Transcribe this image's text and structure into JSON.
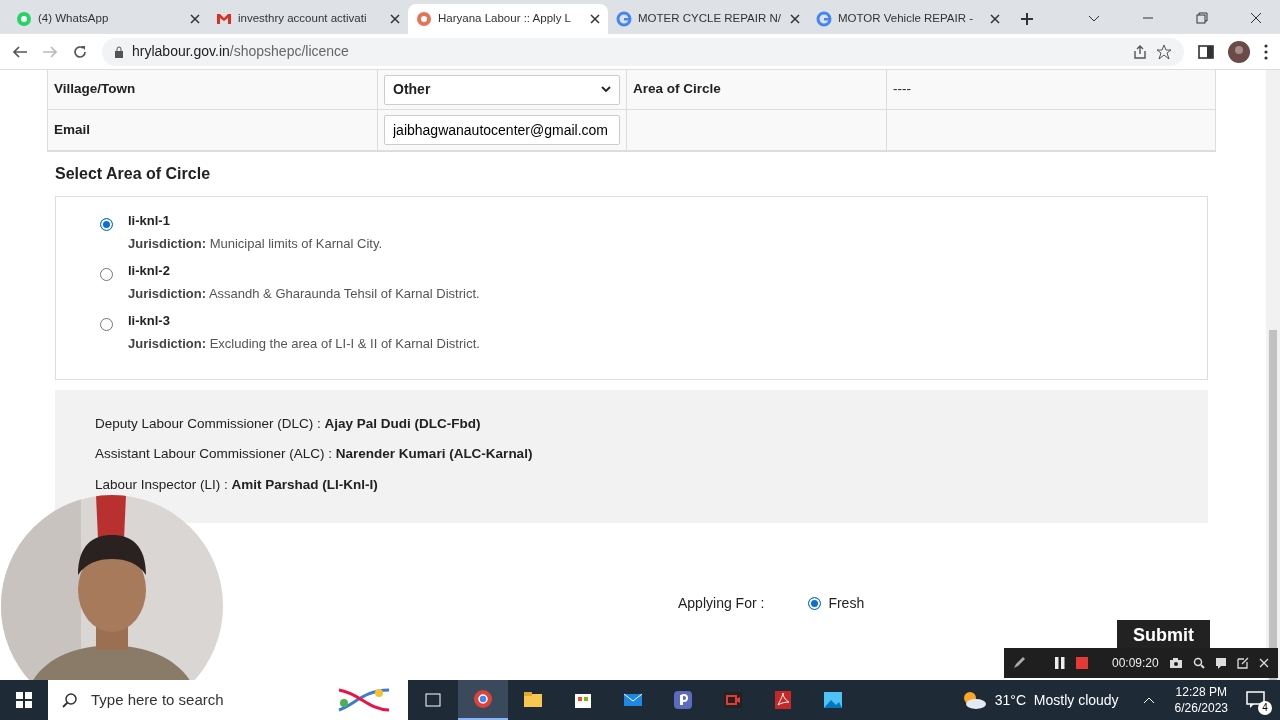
{
  "browser": {
    "tabs": [
      {
        "title": "(4) WhatsApp",
        "selected": false
      },
      {
        "title": "investhry account activati",
        "selected": false
      },
      {
        "title": "Haryana Labour :: Apply L",
        "selected": true
      },
      {
        "title": "MOTER CYCLE REPAIR N/",
        "selected": false
      },
      {
        "title": "MOTOR Vehicle REPAIR -",
        "selected": false
      }
    ],
    "url_host": "hrylabour.gov.in",
    "url_path": "/shopshepc/licence"
  },
  "form_rows": [
    {
      "label": "Village/Town",
      "field": {
        "kind": "select",
        "value": "Other"
      },
      "label_2": "Area of Circle",
      "value_2": "----"
    },
    {
      "label": "Email",
      "field": {
        "kind": "input",
        "value": "jaibhagwanautocenter@gmail.com"
      }
    }
  ],
  "circle_section": {
    "title": "Select Area of Circle",
    "options": [
      {
        "name": "li-knl-1",
        "jurisdiction_label": "Jurisdiction:",
        "jurisdiction": "Municipal limits of Karnal City.",
        "selected": true
      },
      {
        "name": "li-knl-2",
        "jurisdiction_label": "Jurisdiction:",
        "jurisdiction": "Assandh & Gharaunda Tehsil of Karnal District.",
        "selected": false
      },
      {
        "name": "li-knl-3",
        "jurisdiction_label": "Jurisdiction:",
        "jurisdiction": "Excluding the area of LI-I & II of Karnal District.",
        "selected": false
      }
    ]
  },
  "officers": [
    "Deputy Labour Commissioner (DLC) : **Ajay Pal Dudi (DLC-Fbd)**",
    "Assistant Labour Commissioner (ALC) : **Narender Kumari (ALC-Karnal)**",
    "Labour Inspector (LI) : **Amit Parshad (LI-Knl-I)**"
  ],
  "applying_for": {
    "label": "Applying For :",
    "options": [
      {
        "label": "Fresh",
        "selected": true
      }
    ]
  },
  "submit_button": "Submit",
  "recorder": {
    "time": "00:09:20"
  },
  "taskbar": {
    "search_placeholder": "Type here to search",
    "weather": "31°C  Mostly cloudy",
    "time": "12:28 PM",
    "date": "6/26/2023",
    "notifications": "4"
  }
}
